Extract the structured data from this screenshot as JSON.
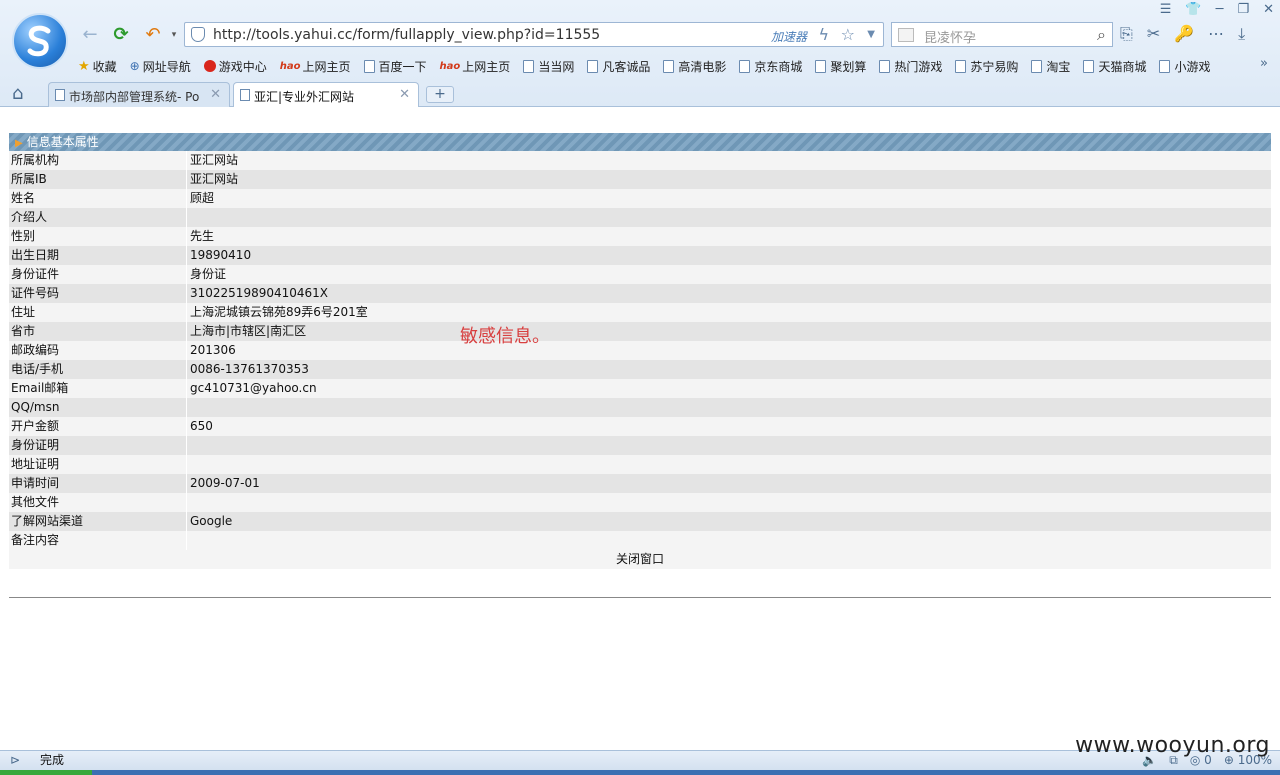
{
  "browser": {
    "url": "http://tools.yahui.cc/form/fullapply_view.php?id=11555",
    "accelerator_label": "加速器",
    "search_placeholder": "昆凌怀孕",
    "favorites": [
      {
        "label": "收藏",
        "icon": "star-icon"
      },
      {
        "label": "网址导航",
        "icon": "globe-icon"
      },
      {
        "label": "游戏中心",
        "icon": "game-icon"
      },
      {
        "label": "上网主页",
        "icon": "hao-icon"
      },
      {
        "label": "百度一下",
        "icon": "page-icon"
      },
      {
        "label": "上网主页",
        "icon": "hao-icon"
      },
      {
        "label": "当当网",
        "icon": "page-icon"
      },
      {
        "label": "凡客诚品",
        "icon": "page-icon"
      },
      {
        "label": "高清电影",
        "icon": "page-icon"
      },
      {
        "label": "京东商城",
        "icon": "page-icon"
      },
      {
        "label": "聚划算",
        "icon": "page-icon"
      },
      {
        "label": "热门游戏",
        "icon": "page-icon"
      },
      {
        "label": "苏宁易购",
        "icon": "page-icon"
      },
      {
        "label": "淘宝",
        "icon": "page-icon"
      },
      {
        "label": "天猫商城",
        "icon": "page-icon"
      },
      {
        "label": "小游戏",
        "icon": "page-icon"
      }
    ],
    "tabs": [
      {
        "label": "市场部内部管理系统- Po"
      },
      {
        "label": "亚汇|专业外汇网站"
      }
    ],
    "status_text": "完成",
    "status_count": "0",
    "zoom": "100%"
  },
  "panel": {
    "header": "信息基本属性",
    "rows": [
      {
        "key": "所属机构",
        "value": "亚汇网站"
      },
      {
        "key": "所属IB",
        "value": "亚汇网站"
      },
      {
        "key": "姓名",
        "value": "顾超"
      },
      {
        "key": "介绍人",
        "value": ""
      },
      {
        "key": "性别",
        "value": "先生"
      },
      {
        "key": "出生日期",
        "value": "19890410"
      },
      {
        "key": "身份证件",
        "value": "身份证"
      },
      {
        "key": "证件号码",
        "value": "31022519890410461X"
      },
      {
        "key": "住址",
        "value": "上海泥城镇云锦苑89弄6号201室"
      },
      {
        "key": "省市",
        "value": "上海市|市辖区|南汇区"
      },
      {
        "key": "邮政编码",
        "value": "201306"
      },
      {
        "key": "电话/手机",
        "value": "0086-13761370353"
      },
      {
        "key": "Email邮箱",
        "value": "gc410731@yahoo.cn"
      },
      {
        "key": "QQ/msn",
        "value": ""
      },
      {
        "key": "开户金额",
        "value": "650"
      },
      {
        "key": "身份证明",
        "value": ""
      },
      {
        "key": "地址证明",
        "value": ""
      },
      {
        "key": "申请时间",
        "value": "2009-07-01"
      },
      {
        "key": "其他文件",
        "value": ""
      },
      {
        "key": "了解网站渠道",
        "value": "Google"
      },
      {
        "key": "备注内容",
        "value": ""
      }
    ],
    "close_label": "关闭窗口"
  },
  "annotation": "敏感信息。",
  "watermark": "www.wooyun.org",
  "colors": {
    "header_bg": "#6f97b6",
    "annotation": "#d84040",
    "chrome": "#dde9f6"
  }
}
